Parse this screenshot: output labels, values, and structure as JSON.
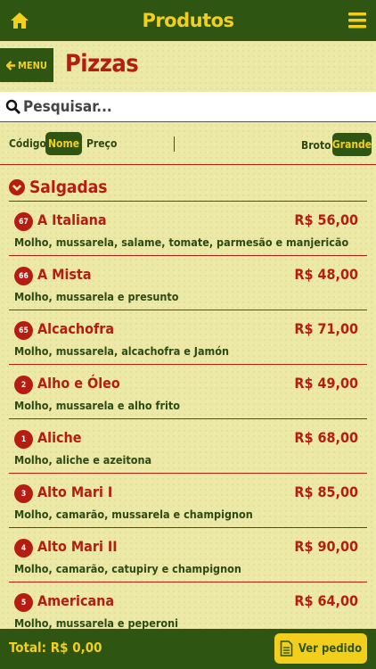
{
  "topbar": {
    "title": "Produtos",
    "home_icon": "home-icon",
    "menu_icon": "hamburger-menu-icon"
  },
  "header": {
    "back_label": "MENU",
    "back_icon": "arrow-left-icon",
    "page_title": "Pizzas"
  },
  "search": {
    "placeholder": "Pesquisar...",
    "value": ""
  },
  "sort": {
    "code_label": "Código",
    "name_label": "Nome",
    "price_label": "Preço",
    "active": "Nome",
    "size_broto": "Broto",
    "size_grande": "Grande",
    "size_active": "Grande"
  },
  "section": {
    "title": "Salgadas",
    "icon": "chevron-down-circle-icon"
  },
  "items": [
    {
      "num": "67",
      "name": "A Italiana",
      "price": "R$ 56,00",
      "desc": "Molho, mussarela, salame, tomate, parmesão e manjericão"
    },
    {
      "num": "66",
      "name": "A Mista",
      "price": "R$ 48,00",
      "desc": "Molho, mussarela e presunto"
    },
    {
      "num": "65",
      "name": "Alcachofra",
      "price": "R$ 71,00",
      "desc": "Molho, mussarela, alcachofra e Jamón"
    },
    {
      "num": "2",
      "name": "Alho e Óleo",
      "price": "R$ 49,00",
      "desc": "Molho, mussarela e alho frito"
    },
    {
      "num": "1",
      "name": "Aliche",
      "price": "R$ 68,00",
      "desc": "Molho, aliche e azeitona"
    },
    {
      "num": "3",
      "name": "Alto Mari I",
      "price": "R$ 85,00",
      "desc": "Molho, camarão, mussarela e champignon"
    },
    {
      "num": "4",
      "name": "Alto Mari II",
      "price": "R$ 90,00",
      "desc": "Molho, camarão, catupiry e champignon"
    },
    {
      "num": "5",
      "name": "Americana",
      "price": "R$ 64,00",
      "desc": "Molho, mussarela e peperoni"
    }
  ],
  "footer": {
    "total": "Total: R$ 0,00",
    "order_label": "Ver pedido",
    "order_icon": "document-icon"
  },
  "colors": {
    "dark_green": "#2f5512",
    "yellow": "#f2cf1c",
    "red": "#b51d12",
    "background": "#ece8a6"
  }
}
